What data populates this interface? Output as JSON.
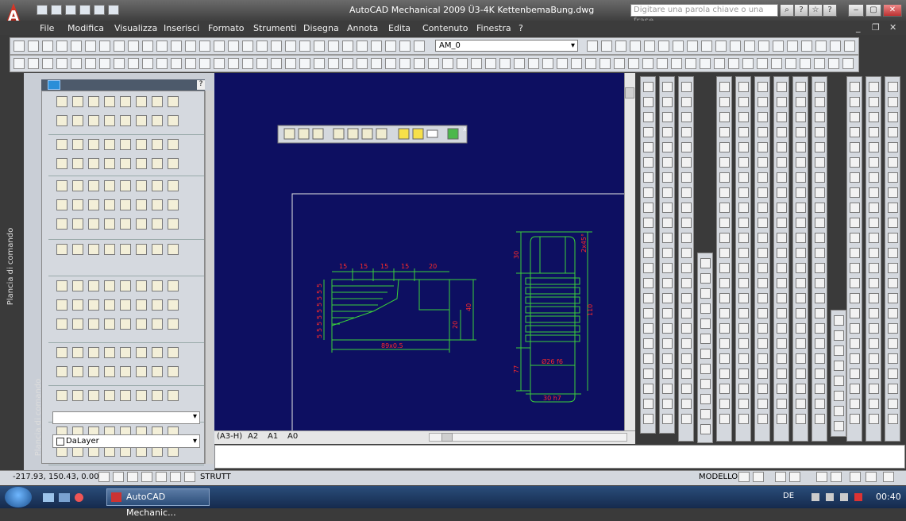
{
  "window": {
    "title": "AutoCAD Mechanical 2009  Ü3-4K KettenbemaBung.dwg",
    "search_placeholder": "Digitare una parola chiave o una frase"
  },
  "menu": [
    "File",
    "Modifica",
    "Visualizza",
    "Inserisci",
    "Formato",
    "Strumenti",
    "Disegna",
    "Annota",
    "Edita",
    "Contenuto",
    "Finestra",
    "?"
  ],
  "toolbar": {
    "layer_value": "AM_0"
  },
  "left_panel": {
    "label": "Plancia di comando",
    "layer_select": "DaLayer",
    "bottom_label": "Plancia di comando"
  },
  "drawing": {
    "dims_top": [
      "15",
      "15",
      "15",
      "15",
      "20"
    ],
    "dims_left": [
      "5",
      "5",
      "5",
      "5",
      "5",
      "5",
      "5",
      "5",
      "5"
    ],
    "dim_bottom": "89x0.5",
    "dim_right_1": "40",
    "dim_right_2": "20",
    "shaft_dim_top": "2x45°",
    "shaft_dim_left_1": "30",
    "shaft_dim_left_2": "77",
    "shaft_dim_right": "110",
    "shaft_dim_dia": "Ø26 f6",
    "shaft_dim_bottom": "30 h7"
  },
  "tabs": [
    "(A3-H)",
    "A2",
    "A1",
    "A0"
  ],
  "status": {
    "coords": "-217.93, 150.43, 0.00",
    "strutt": "STRUTT",
    "modello": "MODELLO"
  },
  "taskbar": {
    "item": "AutoCAD Mechanic...",
    "lang": "DE",
    "clock": "00:40"
  },
  "colors": {
    "canvas": "#0d0f61",
    "drawing_green": "#3ad13a",
    "dim_red": "#ff2a2a",
    "frame_white": "#e8e8e8"
  }
}
